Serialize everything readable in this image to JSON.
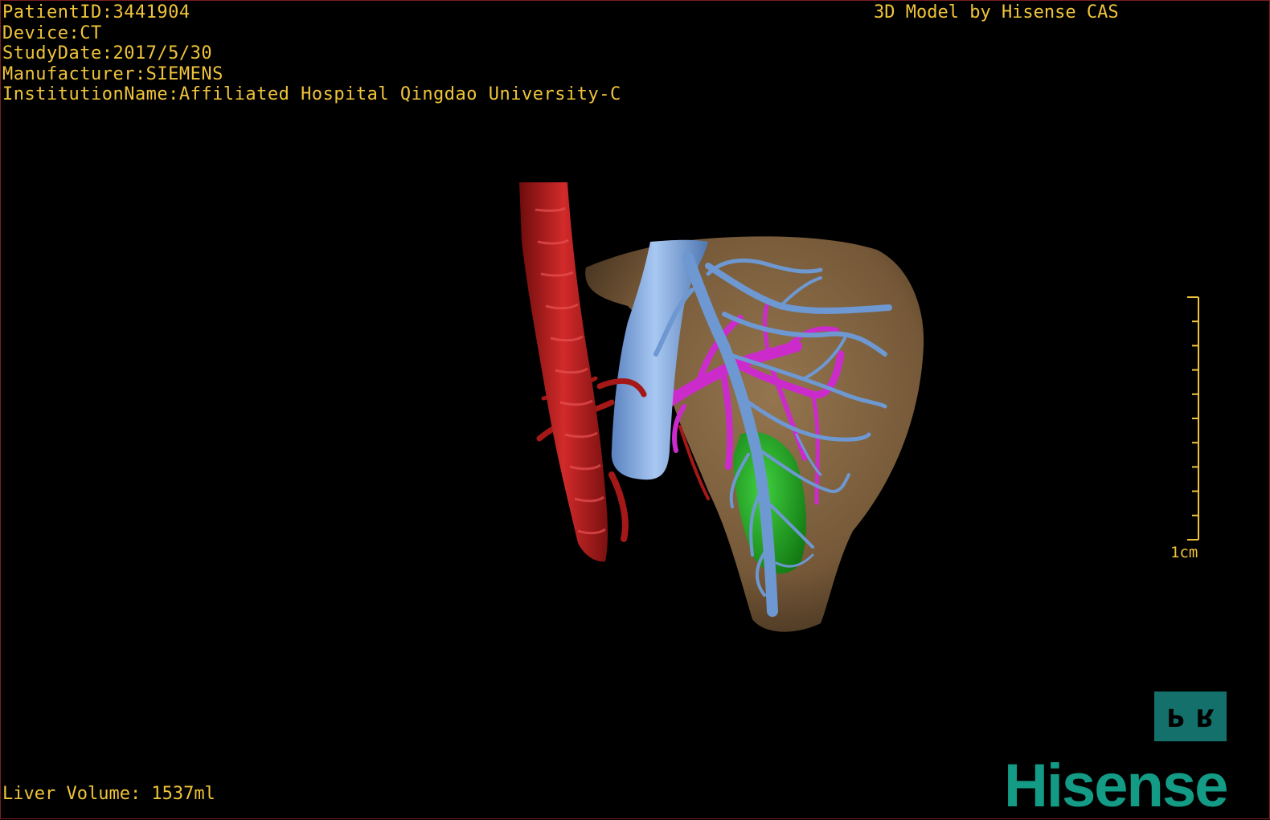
{
  "patient_info": {
    "patient_id": "PatientID:3441904",
    "device": "Device:CT",
    "study_date": "StudyDate:2017/5/30",
    "manufacturer": "Manufacturer:SIEMENS",
    "institution": "InstitutionName:Affiliated Hospital Qingdao University-C"
  },
  "header_right": {
    "model_by": "3D Model by Hisense CAS"
  },
  "footer": {
    "liver_volume": "Liver Volume: 1537ml"
  },
  "scale_bar": {
    "label": "1cm",
    "tick_count": 11
  },
  "orientation_cube": {
    "left_glyph": "P",
    "right_glyph": "R"
  },
  "brand": {
    "logo": "Hisense"
  },
  "colors": {
    "overlay_text": "#f0c43a",
    "liver": "#8a6a44",
    "hepatic_vein": "#7aa6e0",
    "portal_vein": "#cc2bcc",
    "artery": "#b51c1c",
    "tumor": "#1fa51f",
    "brand_teal": "#139b86",
    "orientation_bg": "#13706a"
  },
  "model_structures": [
    "liver",
    "inferior-vena-cava",
    "hepatic-veins",
    "portal-veins",
    "aorta",
    "tumor"
  ]
}
